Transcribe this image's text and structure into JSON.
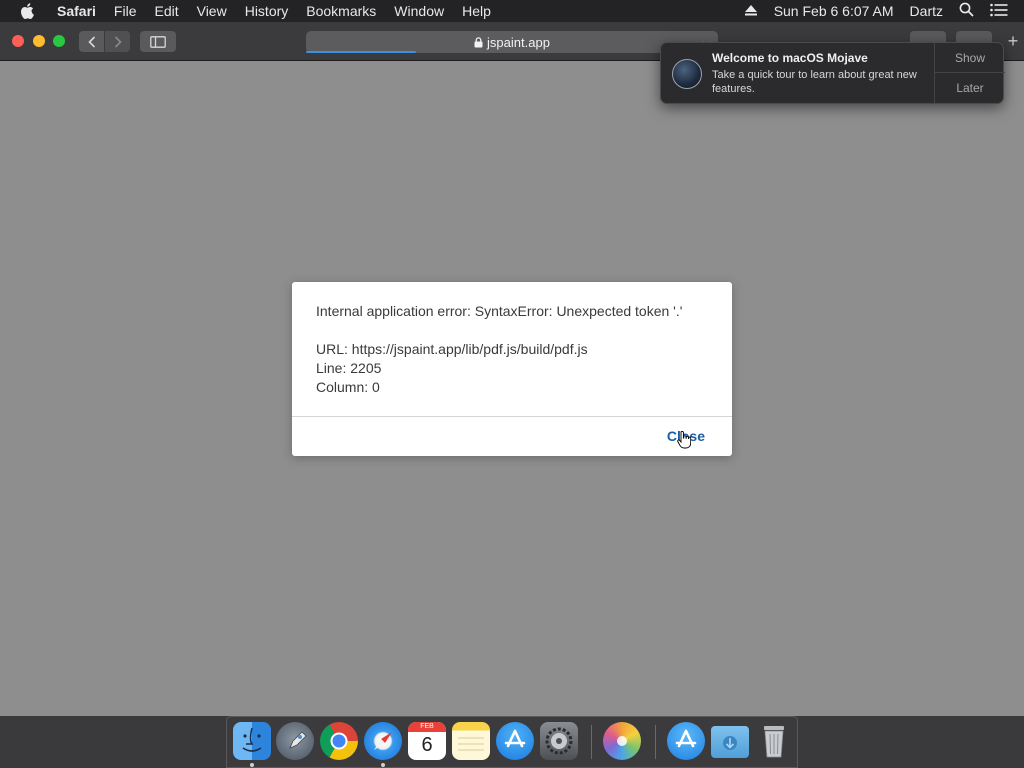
{
  "menubar": {
    "app_name": "Safari",
    "items": [
      "File",
      "Edit",
      "View",
      "History",
      "Bookmarks",
      "Window",
      "Help"
    ],
    "clock": "Sun Feb 6  6:07 AM",
    "user": "Dartz"
  },
  "browser": {
    "url": "jspaint.app"
  },
  "dialog": {
    "error_line": "Internal application error: SyntaxError: Unexpected token '.'",
    "url_line": "URL: https://jspaint.app/lib/pdf.js/build/pdf.js",
    "line_line": "Line: 2205",
    "column_line": "Column: 0",
    "close_label": "Close"
  },
  "notification": {
    "title": "Welcome to macOS Mojave",
    "text": "Take a quick tour to learn about great new features.",
    "show_label": "Show",
    "later_label": "Later"
  },
  "dock": {
    "items": [
      "finder-icon",
      "launchpad-icon",
      "chrome-icon",
      "safari-icon",
      "calendar-icon",
      "notes-icon",
      "app-store-icon",
      "system-preferences-icon",
      "photos-icon",
      "app-store-folder-icon",
      "downloads-folder-icon",
      "trash-icon"
    ],
    "calendar_month": "FEB",
    "calendar_day": "6"
  },
  "colors": {
    "accent": "#3d8fe0",
    "link": "#1a5ea8"
  }
}
